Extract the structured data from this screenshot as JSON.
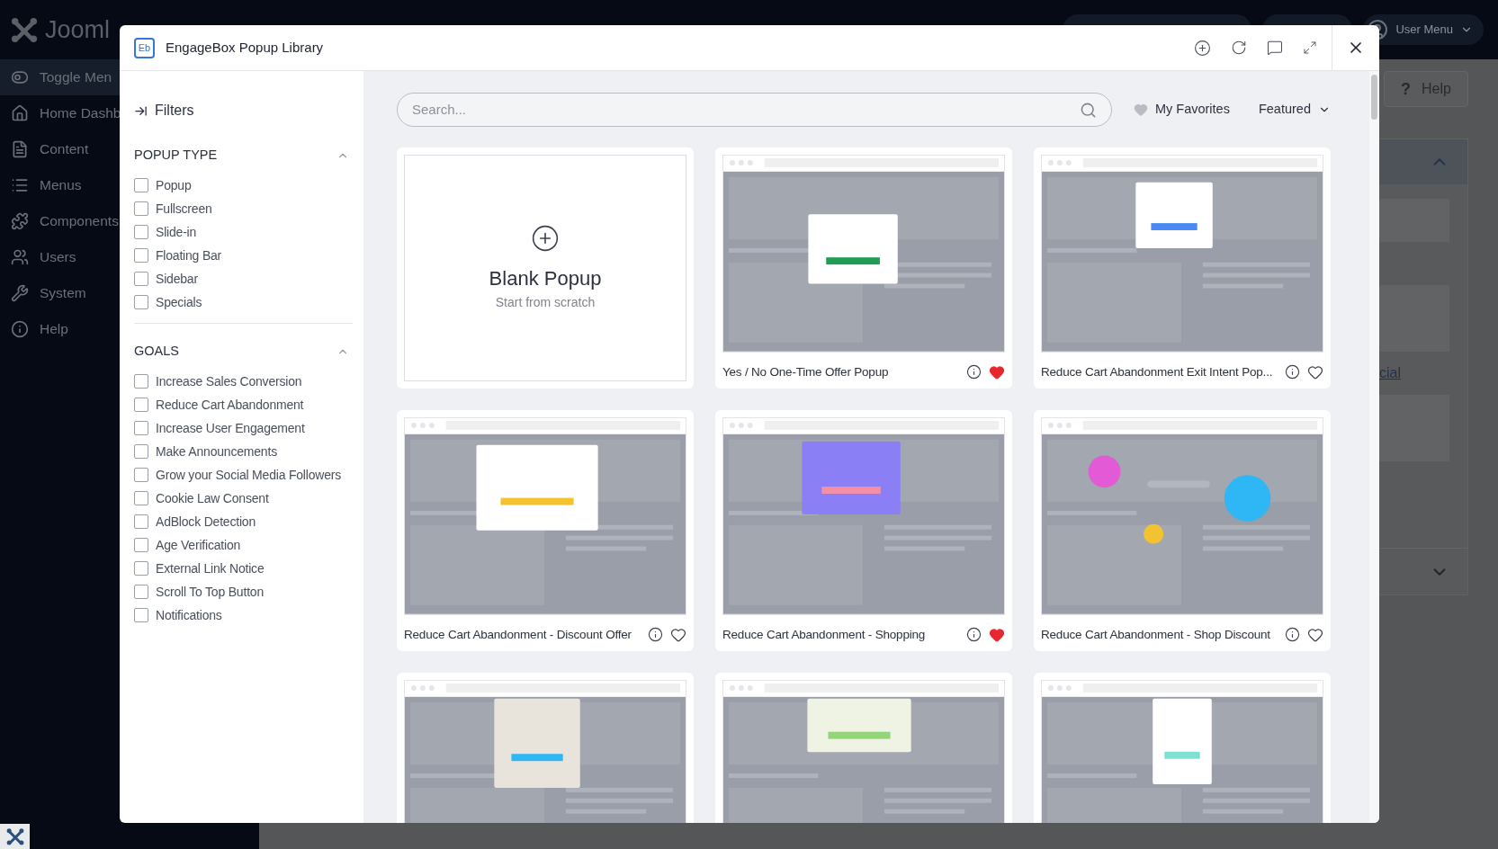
{
  "backdrop": {
    "logo_text": "Jooml",
    "sidebar": [
      {
        "label": "Toggle Men",
        "kind": "toggle",
        "selected": true
      },
      {
        "label": "Home Dashb",
        "kind": "home",
        "selected": false
      },
      {
        "label": "Content",
        "kind": "content",
        "selected": false
      },
      {
        "label": "Menus",
        "kind": "menus",
        "selected": false
      },
      {
        "label": "Components",
        "kind": "components",
        "selected": false
      },
      {
        "label": "Users",
        "kind": "users",
        "selected": false
      },
      {
        "label": "System",
        "kind": "system",
        "selected": false
      },
      {
        "label": "Help",
        "kind": "help",
        "selected": false
      }
    ],
    "user_menu": "User Menu",
    "help_mark": "?",
    "help_button": "Help",
    "link": "cial"
  },
  "modal": {
    "title": "EngageBox Popup Library",
    "logo": "Eb",
    "filters": {
      "title": "Filters",
      "sections": [
        {
          "title": "POPUP TYPE",
          "expanded": true,
          "options": [
            {
              "label": "Popup",
              "checked": false
            },
            {
              "label": "Fullscreen",
              "checked": false
            },
            {
              "label": "Slide-in",
              "checked": false
            },
            {
              "label": "Floating Bar",
              "checked": false
            },
            {
              "label": "Sidebar",
              "checked": false
            },
            {
              "label": "Specials",
              "checked": false
            }
          ]
        },
        {
          "title": "GOALS",
          "expanded": true,
          "options": [
            {
              "label": "Increase Sales Conversion",
              "checked": false
            },
            {
              "label": "Reduce Cart Abandonment",
              "checked": false
            },
            {
              "label": "Increase User Engagement",
              "checked": false
            },
            {
              "label": "Make Announcements",
              "checked": false
            },
            {
              "label": "Grow your Social Media Followers",
              "checked": false
            },
            {
              "label": "Cookie Law Consent",
              "checked": false
            },
            {
              "label": "AdBlock Detection",
              "checked": false
            },
            {
              "label": "Age Verification",
              "checked": false
            },
            {
              "label": "External Link Notice",
              "checked": false
            },
            {
              "label": "Scroll To Top Button",
              "checked": false
            },
            {
              "label": "Notifications",
              "checked": false
            }
          ]
        }
      ]
    },
    "search": {
      "placeholder": "Search..."
    },
    "favorites_label": "My Favorites",
    "sort": "Featured",
    "templates": [
      {
        "kind": "blank",
        "title": "Blank Popup",
        "subtitle": "Start from scratch"
      },
      {
        "kind": "template",
        "title": "Yes / No One-Time Offer Popup",
        "favorite": true
      },
      {
        "kind": "template",
        "title": "Reduce Cart Abandonment Exit Intent Pop...",
        "favorite": false
      },
      {
        "kind": "template",
        "title": "Reduce Cart Abandonment - Discount Offer",
        "favorite": false
      },
      {
        "kind": "template",
        "title": "Reduce Cart Abandonment - Shopping",
        "favorite": true
      },
      {
        "kind": "template",
        "title": "Reduce Cart Abandonment - Shop Discount",
        "favorite": false
      },
      {
        "kind": "template"
      },
      {
        "kind": "template"
      },
      {
        "kind": "template"
      }
    ]
  }
}
